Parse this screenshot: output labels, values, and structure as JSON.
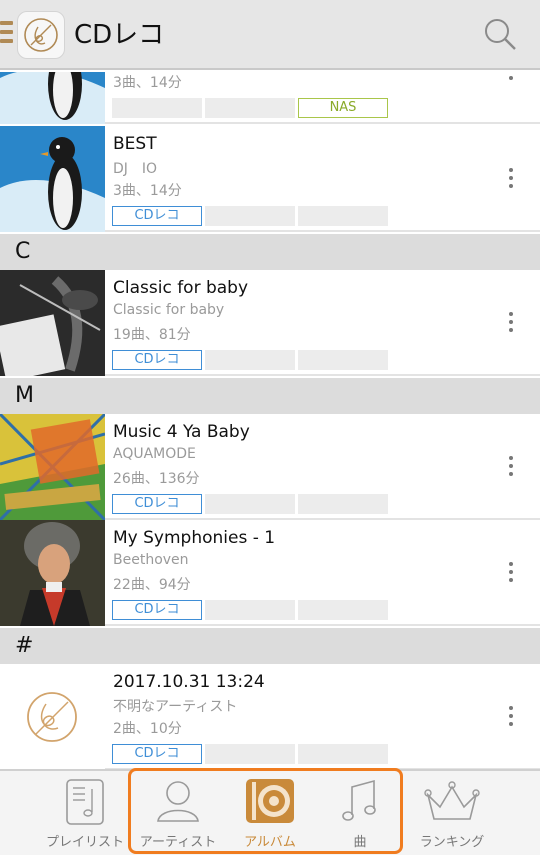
{
  "header": {
    "app_title": "CDレコ",
    "icons": {
      "menu": "hamburger-icon",
      "logo": "cdreco-logo-icon",
      "search": "search-icon"
    },
    "accent_color": "#b08a55"
  },
  "rows": [
    {
      "id": "row0",
      "title": "",
      "artist": "",
      "meta": "3曲、14分",
      "tags": [
        "",
        "",
        "NAS"
      ],
      "thumb": "penguin"
    },
    {
      "id": "row1",
      "title": "BEST",
      "artist": "DJ　IO",
      "meta": "3曲、14分",
      "tags": [
        "CDレコ",
        "",
        ""
      ],
      "thumb": "penguin"
    },
    {
      "id": "row2",
      "title": "Classic for baby",
      "artist": "Classic for baby",
      "meta": "19曲、81分",
      "tags": [
        "CDレコ",
        "",
        ""
      ],
      "thumb": "violin"
    },
    {
      "id": "row3",
      "title": "Music 4 Ya Baby",
      "artist": "AQUAMODE",
      "meta": "26曲、136分",
      "tags": [
        "CDレコ",
        "",
        ""
      ],
      "thumb": "aquamode"
    },
    {
      "id": "row4",
      "title": "My Symphonies - 1",
      "artist": "Beethoven",
      "meta": "22曲、94分",
      "tags": [
        "CDレコ",
        "",
        ""
      ],
      "thumb": "beethoven"
    },
    {
      "id": "row5",
      "title": "2017.10.31 13:24",
      "artist": "不明なアーティスト",
      "meta": "2曲、10分",
      "tags": [
        "CDレコ",
        "",
        ""
      ],
      "thumb": "logo"
    }
  ],
  "sections": [
    "C",
    "M",
    "#"
  ],
  "bottom_nav": [
    {
      "label": "プレイリスト",
      "icon": "playlist-icon",
      "active": false
    },
    {
      "label": "アーティスト",
      "icon": "artist-icon",
      "active": false
    },
    {
      "label": "アルバム",
      "icon": "album-icon",
      "active": true
    },
    {
      "label": "曲",
      "icon": "music-note-icon",
      "active": false
    },
    {
      "label": "ランキング",
      "icon": "crown-icon",
      "active": false
    }
  ],
  "colors": {
    "cd_tag": "#3f8ed6",
    "nas_tag": "#a9c64a",
    "active_nav": "#c98a3a",
    "highlight": "#f07c1f"
  }
}
